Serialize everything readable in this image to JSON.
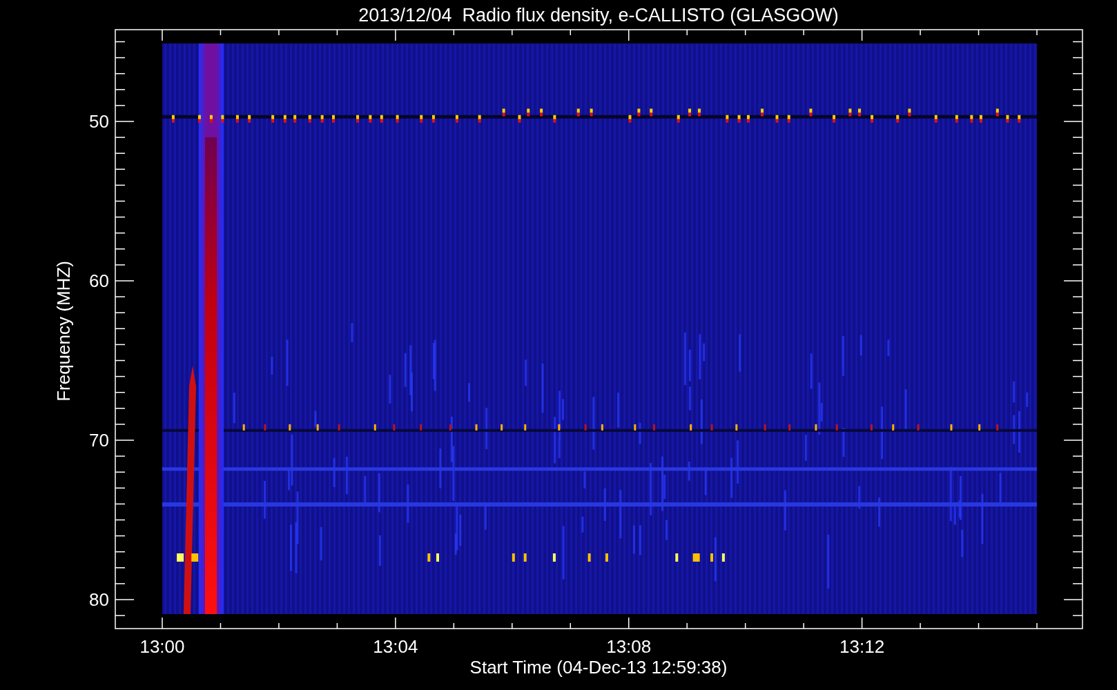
{
  "plot": {
    "title": "2013/12/04  Radio flux density, e-CALLISTO (GLASGOW)",
    "xlabel": "Start Time (04-Dec-13 12:59:38)",
    "ylabel": "Frequency (MHZ)",
    "y_tick_labels": [
      "50",
      "60",
      "70",
      "80"
    ],
    "x_tick_labels": [
      "13:00",
      "13:04",
      "13:08",
      "13:12"
    ]
  }
}
